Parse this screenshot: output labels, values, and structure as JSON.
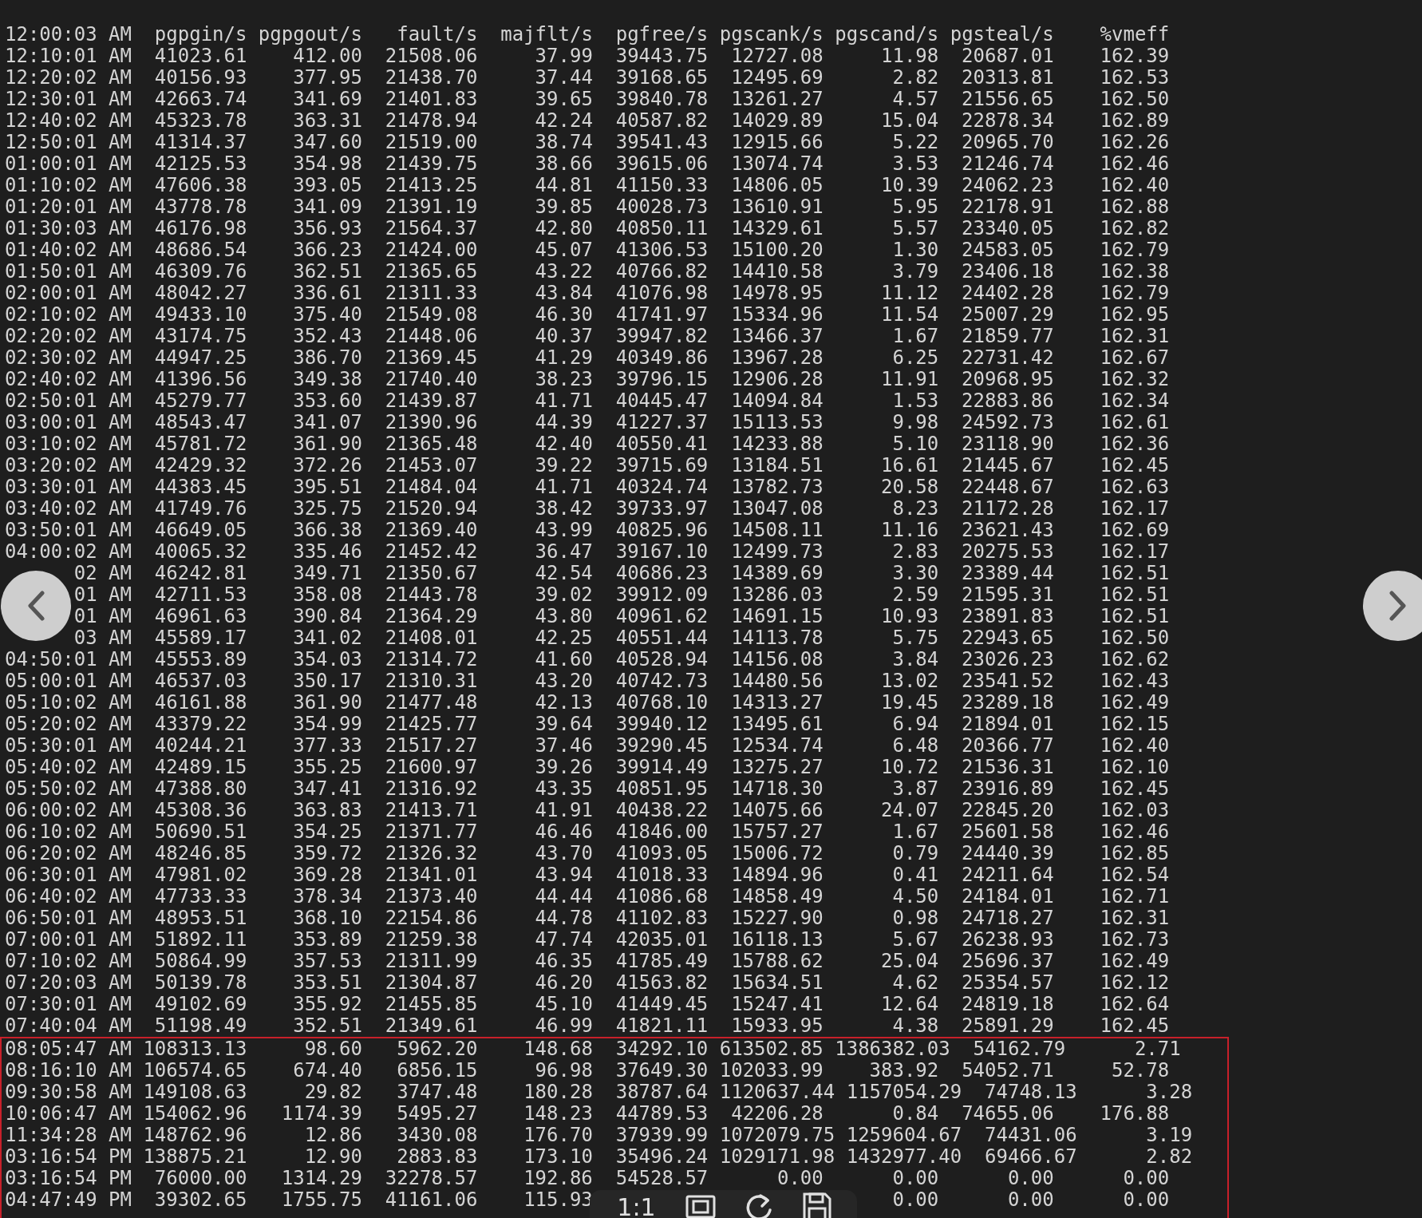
{
  "terminal": {
    "header": [
      "12:00:03 AM",
      "pgpgin/s",
      "pgpgout/s",
      "fault/s",
      "majflt/s",
      "pgfree/s",
      "pgscank/s",
      "pgscand/s",
      "pgsteal/s",
      "%vmeff"
    ],
    "rows": [
      [
        "12:10:01 AM",
        "41023.61",
        "412.00",
        "21508.06",
        "37.99",
        "39443.75",
        "12727.08",
        "11.98",
        "20687.01",
        "162.39"
      ],
      [
        "12:20:02 AM",
        "40156.93",
        "377.95",
        "21438.70",
        "37.44",
        "39168.65",
        "12495.69",
        "2.82",
        "20313.81",
        "162.53"
      ],
      [
        "12:30:01 AM",
        "42663.74",
        "341.69",
        "21401.83",
        "39.65",
        "39840.78",
        "13261.27",
        "4.57",
        "21556.65",
        "162.50"
      ],
      [
        "12:40:02 AM",
        "45323.78",
        "363.31",
        "21478.94",
        "42.24",
        "40587.82",
        "14029.89",
        "15.04",
        "22878.34",
        "162.89"
      ],
      [
        "12:50:01 AM",
        "41314.37",
        "347.60",
        "21519.00",
        "38.74",
        "39541.43",
        "12915.66",
        "5.22",
        "20965.70",
        "162.26"
      ],
      [
        "01:00:01 AM",
        "42125.53",
        "354.98",
        "21439.75",
        "38.66",
        "39615.06",
        "13074.74",
        "3.53",
        "21246.74",
        "162.46"
      ],
      [
        "01:10:02 AM",
        "47606.38",
        "393.05",
        "21413.25",
        "44.81",
        "41150.33",
        "14806.05",
        "10.39",
        "24062.23",
        "162.40"
      ],
      [
        "01:20:01 AM",
        "43778.78",
        "341.09",
        "21391.19",
        "39.85",
        "40028.73",
        "13610.91",
        "5.95",
        "22178.91",
        "162.88"
      ],
      [
        "01:30:03 AM",
        "46176.98",
        "356.93",
        "21564.37",
        "42.80",
        "40850.11",
        "14329.61",
        "5.57",
        "23340.05",
        "162.82"
      ],
      [
        "01:40:02 AM",
        "48686.54",
        "366.23",
        "21424.00",
        "45.07",
        "41306.53",
        "15100.20",
        "1.30",
        "24583.05",
        "162.79"
      ],
      [
        "01:50:01 AM",
        "46309.76",
        "362.51",
        "21365.65",
        "43.22",
        "40766.82",
        "14410.58",
        "3.79",
        "23406.18",
        "162.38"
      ],
      [
        "02:00:01 AM",
        "48042.27",
        "336.61",
        "21311.33",
        "43.84",
        "41076.98",
        "14978.95",
        "11.12",
        "24402.28",
        "162.79"
      ],
      [
        "02:10:02 AM",
        "49433.10",
        "375.40",
        "21549.08",
        "46.30",
        "41741.97",
        "15334.96",
        "11.54",
        "25007.29",
        "162.95"
      ],
      [
        "02:20:02 AM",
        "43174.75",
        "352.43",
        "21448.06",
        "40.37",
        "39947.82",
        "13466.37",
        "1.67",
        "21859.77",
        "162.31"
      ],
      [
        "02:30:02 AM",
        "44947.25",
        "386.70",
        "21369.45",
        "41.29",
        "40349.86",
        "13967.28",
        "6.25",
        "22731.42",
        "162.67"
      ],
      [
        "02:40:02 AM",
        "41396.56",
        "349.38",
        "21740.40",
        "38.23",
        "39796.15",
        "12906.28",
        "11.91",
        "20968.95",
        "162.32"
      ],
      [
        "02:50:01 AM",
        "45279.77",
        "353.60",
        "21439.87",
        "41.71",
        "40445.47",
        "14094.84",
        "1.53",
        "22883.86",
        "162.34"
      ],
      [
        "03:00:01 AM",
        "48543.47",
        "341.07",
        "21390.96",
        "44.39",
        "41227.37",
        "15113.53",
        "9.98",
        "24592.73",
        "162.61"
      ],
      [
        "03:10:02 AM",
        "45781.72",
        "361.90",
        "21365.48",
        "42.40",
        "40550.41",
        "14233.88",
        "5.10",
        "23118.90",
        "162.36"
      ],
      [
        "03:20:02 AM",
        "42429.32",
        "372.26",
        "21453.07",
        "39.22",
        "39715.69",
        "13184.51",
        "16.61",
        "21445.67",
        "162.45"
      ],
      [
        "03:30:01 AM",
        "44383.45",
        "395.51",
        "21484.04",
        "41.71",
        "40324.74",
        "13782.73",
        "20.58",
        "22448.67",
        "162.63"
      ],
      [
        "03:40:02 AM",
        "41749.76",
        "325.75",
        "21520.94",
        "38.42",
        "39733.97",
        "13047.08",
        "8.23",
        "21172.28",
        "162.17"
      ],
      [
        "03:50:01 AM",
        "46649.05",
        "366.38",
        "21369.40",
        "43.99",
        "40825.96",
        "14508.11",
        "11.16",
        "23621.43",
        "162.69"
      ],
      [
        "04:00:02 AM",
        "40065.32",
        "335.46",
        "21452.42",
        "36.47",
        "39167.10",
        "12499.73",
        "2.83",
        "20275.53",
        "162.17"
      ],
      [
        "02 AM",
        "46242.81",
        "349.71",
        "21350.67",
        "42.54",
        "40686.23",
        "14389.69",
        "3.30",
        "23389.44",
        "162.51"
      ],
      [
        "01 AM",
        "42711.53",
        "358.08",
        "21443.78",
        "39.02",
        "39912.09",
        "13286.03",
        "2.59",
        "21595.31",
        "162.51"
      ],
      [
        "01 AM",
        "46961.63",
        "390.84",
        "21364.29",
        "43.80",
        "40961.62",
        "14691.15",
        "10.93",
        "23891.83",
        "162.51"
      ],
      [
        "03 AM",
        "45589.17",
        "341.02",
        "21408.01",
        "42.25",
        "40551.44",
        "14113.78",
        "5.75",
        "22943.65",
        "162.50"
      ],
      [
        "04:50:01 AM",
        "45553.89",
        "354.03",
        "21314.72",
        "41.60",
        "40528.94",
        "14156.08",
        "3.84",
        "23026.23",
        "162.62"
      ],
      [
        "05:00:01 AM",
        "46537.03",
        "350.17",
        "21310.31",
        "43.20",
        "40742.73",
        "14480.56",
        "13.02",
        "23541.52",
        "162.43"
      ],
      [
        "05:10:02 AM",
        "46161.88",
        "361.90",
        "21477.48",
        "42.13",
        "40768.10",
        "14313.27",
        "19.45",
        "23289.18",
        "162.49"
      ],
      [
        "05:20:02 AM",
        "43379.22",
        "354.99",
        "21425.77",
        "39.64",
        "39940.12",
        "13495.61",
        "6.94",
        "21894.01",
        "162.15"
      ],
      [
        "05:30:01 AM",
        "40244.21",
        "377.33",
        "21517.27",
        "37.46",
        "39290.45",
        "12534.74",
        "6.48",
        "20366.77",
        "162.40"
      ],
      [
        "05:40:02 AM",
        "42489.15",
        "355.25",
        "21600.97",
        "39.26",
        "39914.49",
        "13275.27",
        "10.72",
        "21536.31",
        "162.10"
      ],
      [
        "05:50:02 AM",
        "47388.80",
        "347.41",
        "21316.92",
        "43.35",
        "40851.95",
        "14718.30",
        "3.87",
        "23916.89",
        "162.45"
      ],
      [
        "06:00:02 AM",
        "45308.36",
        "363.83",
        "21413.71",
        "41.91",
        "40438.22",
        "14075.66",
        "24.07",
        "22845.20",
        "162.03"
      ],
      [
        "06:10:02 AM",
        "50690.51",
        "354.25",
        "21371.77",
        "46.46",
        "41846.00",
        "15757.27",
        "1.67",
        "25601.58",
        "162.46"
      ],
      [
        "06:20:02 AM",
        "48246.85",
        "359.72",
        "21326.32",
        "43.70",
        "41093.05",
        "15006.72",
        "0.79",
        "24440.39",
        "162.85"
      ],
      [
        "06:30:01 AM",
        "47981.02",
        "369.28",
        "21341.01",
        "43.94",
        "41018.33",
        "14894.96",
        "0.41",
        "24211.64",
        "162.54"
      ],
      [
        "06:40:02 AM",
        "47733.33",
        "378.34",
        "21373.40",
        "44.44",
        "41086.68",
        "14858.49",
        "4.50",
        "24184.01",
        "162.71"
      ],
      [
        "06:50:01 AM",
        "48953.51",
        "368.10",
        "22154.86",
        "44.78",
        "41102.83",
        "15227.90",
        "0.98",
        "24718.27",
        "162.31"
      ],
      [
        "07:00:01 AM",
        "51892.11",
        "353.89",
        "21259.38",
        "47.74",
        "42035.01",
        "16118.13",
        "5.67",
        "26238.93",
        "162.73"
      ],
      [
        "07:10:02 AM",
        "50864.99",
        "357.53",
        "21311.99",
        "46.35",
        "41785.49",
        "15788.62",
        "25.04",
        "25696.37",
        "162.49"
      ],
      [
        "07:20:03 AM",
        "50139.78",
        "353.51",
        "21304.87",
        "46.20",
        "41563.82",
        "15634.51",
        "4.62",
        "25354.57",
        "162.12"
      ],
      [
        "07:30:01 AM",
        "49102.69",
        "355.92",
        "21455.85",
        "45.10",
        "41449.45",
        "15247.41",
        "12.64",
        "24819.18",
        "162.64"
      ],
      [
        "07:40:04 AM",
        "51198.49",
        "352.51",
        "21349.61",
        "46.99",
        "41821.11",
        "15933.95",
        "4.38",
        "25891.29",
        "162.45"
      ]
    ]
  },
  "highlight": {
    "rows": [
      [
        "08:05:47 AM",
        "108313.13",
        "98.60",
        "5962.20",
        "148.68",
        "34292.10",
        "613502.85",
        "1386382.03",
        "54162.79",
        "2.71"
      ],
      [
        "08:16:10 AM",
        "106574.65",
        "674.40",
        "6856.15",
        "96.98",
        "37649.30",
        "102033.99",
        "383.92",
        "54052.71",
        "52.78"
      ],
      [
        "09:30:58 AM",
        "149108.63",
        "29.82",
        "3747.48",
        "180.28",
        "38787.64",
        "1120637.44",
        "1157054.29",
        "74748.13",
        "3.28"
      ],
      [
        "10:06:47 AM",
        "154062.96",
        "1174.39",
        "5495.27",
        "148.23",
        "44789.53",
        "42206.28",
        "0.84",
        "74655.06",
        "176.88"
      ],
      [
        "11:34:28 AM",
        "148762.96",
        "12.86",
        "3430.08",
        "176.70",
        "37939.99",
        "1072079.75",
        "1259604.67",
        "74431.06",
        "3.19"
      ],
      [
        "03:16:54 PM",
        "138875.21",
        "12.90",
        "2883.83",
        "173.10",
        "35496.24",
        "1029171.98",
        "1432977.40",
        "69466.67",
        "2.82"
      ],
      [
        "03:16:54 PM",
        "76000.00",
        "1314.29",
        "32278.57",
        "192.86",
        "54528.57",
        "0.00",
        "0.00",
        "0.00",
        "0.00"
      ],
      [
        "04:47:49 PM",
        "39302.65",
        "1755.75",
        "41161.06",
        "115.93",
        null,
        null,
        "0.00",
        "0.00",
        "0.00"
      ]
    ]
  },
  "viewer": {
    "toolbar": {
      "zoom_label": "1:1"
    }
  }
}
